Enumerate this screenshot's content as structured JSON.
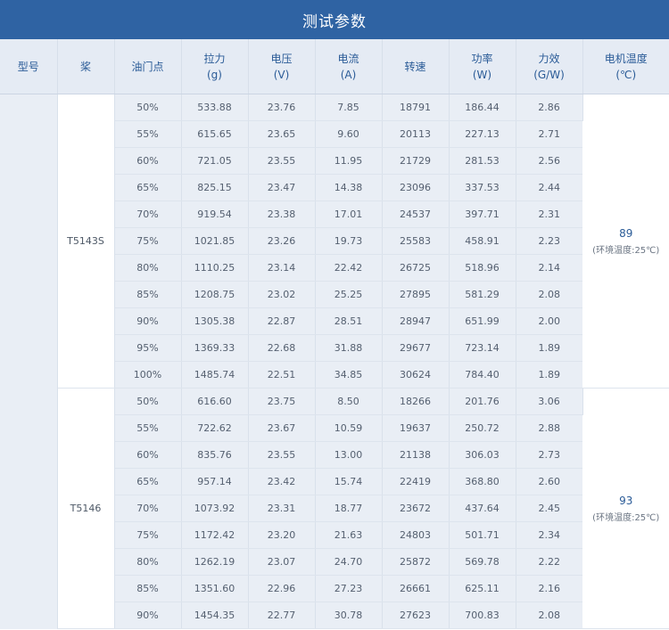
{
  "title": "测试参数",
  "headers": [
    [
      "型号"
    ],
    [
      "桨"
    ],
    [
      "油门点"
    ],
    [
      "拉力",
      "(g)"
    ],
    [
      "电压",
      "(V)"
    ],
    [
      "电流",
      "(A)"
    ],
    [
      "转速"
    ],
    [
      "功率",
      "(W)"
    ],
    [
      "力效",
      "(G/W)"
    ],
    [
      "电机温度",
      "(℃)"
    ]
  ],
  "groups": [
    {
      "prop": "T5143S",
      "temp": "89",
      "temp_note": "(环境温度:25℃)",
      "rows": [
        [
          "50%",
          "533.88",
          "23.76",
          "7.85",
          "18791",
          "186.44",
          "2.86"
        ],
        [
          "55%",
          "615.65",
          "23.65",
          "9.60",
          "20113",
          "227.13",
          "2.71"
        ],
        [
          "60%",
          "721.05",
          "23.55",
          "11.95",
          "21729",
          "281.53",
          "2.56"
        ],
        [
          "65%",
          "825.15",
          "23.47",
          "14.38",
          "23096",
          "337.53",
          "2.44"
        ],
        [
          "70%",
          "919.54",
          "23.38",
          "17.01",
          "24537",
          "397.71",
          "2.31"
        ],
        [
          "75%",
          "1021.85",
          "23.26",
          "19.73",
          "25583",
          "458.91",
          "2.23"
        ],
        [
          "80%",
          "1110.25",
          "23.14",
          "22.42",
          "26725",
          "518.96",
          "2.14"
        ],
        [
          "85%",
          "1208.75",
          "23.02",
          "25.25",
          "27895",
          "581.29",
          "2.08"
        ],
        [
          "90%",
          "1305.38",
          "22.87",
          "28.51",
          "28947",
          "651.99",
          "2.00"
        ],
        [
          "95%",
          "1369.33",
          "22.68",
          "31.88",
          "29677",
          "723.14",
          "1.89"
        ],
        [
          "100%",
          "1485.74",
          "22.51",
          "34.85",
          "30624",
          "784.40",
          "1.89"
        ]
      ]
    },
    {
      "prop": "T5146",
      "temp": "93",
      "temp_note": "(环境温度:25℃)",
      "rows": [
        [
          "50%",
          "616.60",
          "23.75",
          "8.50",
          "18266",
          "201.76",
          "3.06"
        ],
        [
          "55%",
          "722.62",
          "23.67",
          "10.59",
          "19637",
          "250.72",
          "2.88"
        ],
        [
          "60%",
          "835.76",
          "23.55",
          "13.00",
          "21138",
          "306.03",
          "2.73"
        ],
        [
          "65%",
          "957.14",
          "23.42",
          "15.74",
          "22419",
          "368.80",
          "2.60"
        ],
        [
          "70%",
          "1073.92",
          "23.31",
          "18.77",
          "23672",
          "437.64",
          "2.45"
        ],
        [
          "75%",
          "1172.42",
          "23.20",
          "21.63",
          "24803",
          "501.71",
          "2.34"
        ],
        [
          "80%",
          "1262.19",
          "23.07",
          "24.70",
          "25872",
          "569.78",
          "2.22"
        ],
        [
          "85%",
          "1351.60",
          "22.96",
          "27.23",
          "26661",
          "625.11",
          "2.16"
        ],
        [
          "90%",
          "1454.35",
          "22.77",
          "30.78",
          "27623",
          "700.83",
          "2.08"
        ]
      ]
    }
  ]
}
